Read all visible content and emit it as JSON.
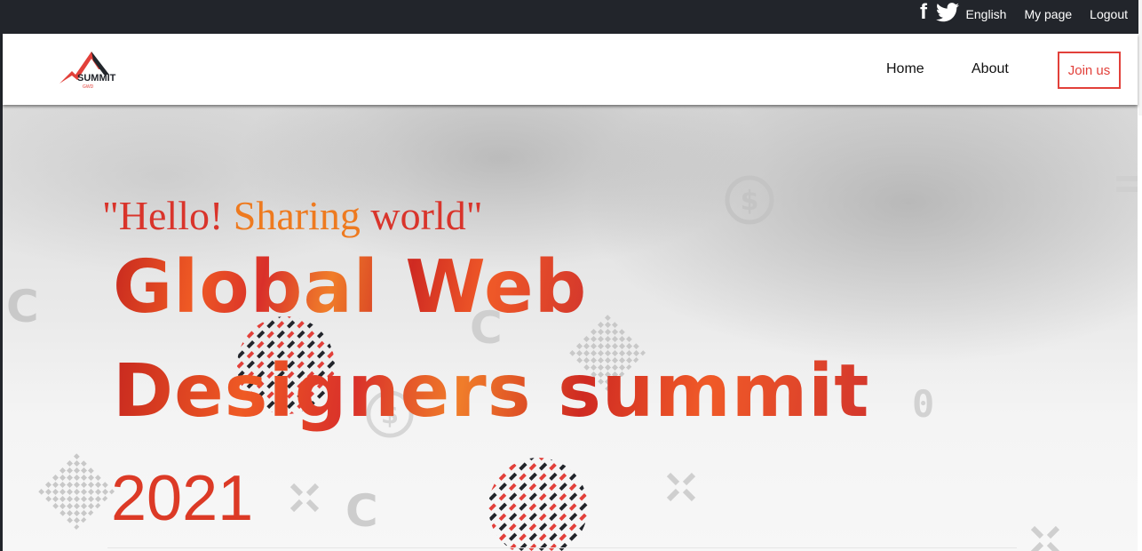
{
  "topbar": {
    "facebook_icon": "facebook-icon",
    "twitter_icon": "twitter-icon",
    "language": "English",
    "my_page": "My page",
    "logout": "Logout"
  },
  "navbar": {
    "logo_alt": "Summit logo",
    "logo_text": "SUMMIT",
    "logo_subtext": "GWD",
    "home": "Home",
    "about": "About",
    "join": "Join us"
  },
  "hero": {
    "quote_open": "\"Hello! ",
    "quote_accent": "Sharing",
    "quote_close": " world\"",
    "headline_line1": "Global Web",
    "headline_line2": "Designers summit",
    "year": "2021",
    "decor_c": "C",
    "decor_zero": "0"
  },
  "colors": {
    "topbar": "#22252b",
    "accent_red": "#e2403a",
    "accent_orange": "#ee7a1f"
  }
}
